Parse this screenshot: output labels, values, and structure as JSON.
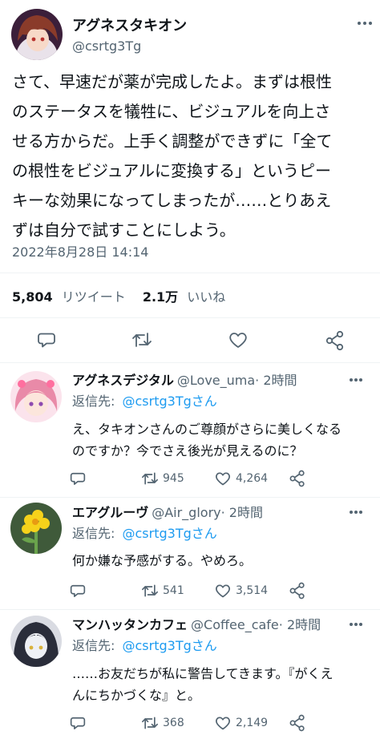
{
  "main_tweet": {
    "display_name": "アグネスタキオン",
    "handle": "@csrtg3Tg",
    "text_lines": [
      "さて、早速だが薬が完成したよ。まずは根性",
      "のステータスを犠牲に、ビジュアルを向上さ",
      "せる方からだ。上手く調整ができずに「全て",
      "の根性をビジュアルに変換する」というピー",
      "キーな効果になってしまったが……とりあえ",
      "ずは自分で試すことにしよう。"
    ],
    "timestamp": "2022年8月28日 14:14",
    "retweet_count": "5,804",
    "retweet_label": "リツイート",
    "like_count": "2.1万",
    "like_label": "いいね"
  },
  "replies": [
    {
      "display_name": "アグネスデジタル",
      "handle": "@Love_uma",
      "time": "· 2時間",
      "reply_to_label": "返信先:",
      "reply_to_handle": "@csrtg3Tgさん",
      "text_lines": [
        "え、タキオンさんのご尊顔がさらに美しくなる",
        "のですか？今でさえ後光が見えるのに？"
      ],
      "retweets": "945",
      "likes": "4,264"
    },
    {
      "display_name": "エアグルーヴ",
      "handle": "@Air_glory",
      "time": "· 2時間",
      "reply_to_label": "返信先:",
      "reply_to_handle": "@csrtg3Tgさん",
      "text_lines": [
        "何か嫌な予感がする。やめろ。"
      ],
      "retweets": "541",
      "likes": "3,514"
    },
    {
      "display_name": "マンハッタンカフェ",
      "handle": "@Coffee_cafe",
      "time": "· 2時間",
      "reply_to_label": "返信先:",
      "reply_to_handle": "@csrtg3Tgさん",
      "text_lines": [
        "……お友だちが私に警告してきます。『がくえ",
        "んにちかづくな』と。"
      ],
      "retweets": "368",
      "likes": "2,149"
    }
  ],
  "colors": {
    "accent": "#1d9bf0",
    "text": "#0f1419",
    "muted": "#536471",
    "divider": "#eff3f4"
  },
  "icons": [
    "reply-icon",
    "retweet-icon",
    "like-icon",
    "share-icon",
    "more-icon"
  ]
}
